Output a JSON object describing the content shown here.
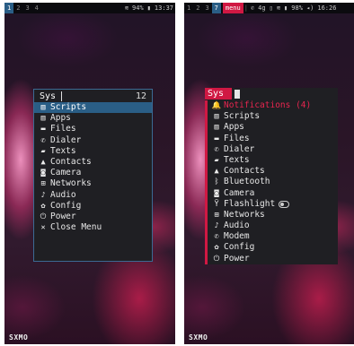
{
  "left": {
    "statusbar": {
      "workspaces": [
        "1",
        "2",
        "3",
        "4"
      ],
      "active_workspace": "1",
      "wifi_icon": "wifi-icon",
      "battery": "94%",
      "battery_icon": "battery-icon",
      "time": "13:37"
    },
    "menu": {
      "prompt": "Sys",
      "count": "12",
      "items": [
        {
          "icon": "scripts-icon",
          "glyph": "▥",
          "label": "Scripts",
          "selected": true
        },
        {
          "icon": "apps-icon",
          "glyph": "▥",
          "label": "Apps"
        },
        {
          "icon": "folder-icon",
          "glyph": "▬",
          "label": "Files"
        },
        {
          "icon": "phone-icon",
          "glyph": "✆",
          "label": "Dialer"
        },
        {
          "icon": "message-icon",
          "glyph": "▰",
          "label": "Texts"
        },
        {
          "icon": "user-icon",
          "glyph": "▲",
          "label": "Contacts"
        },
        {
          "icon": "camera-icon",
          "glyph": "◙",
          "label": "Camera"
        },
        {
          "icon": "network-icon",
          "glyph": "⊞",
          "label": "Networks"
        },
        {
          "icon": "music-icon",
          "glyph": "♪",
          "label": "Audio"
        },
        {
          "icon": "gear-icon",
          "glyph": "✿",
          "label": "Config"
        },
        {
          "icon": "power-icon",
          "glyph": "⏻",
          "label": "Power"
        },
        {
          "icon": "close-icon",
          "glyph": "✕",
          "label": "Close Menu"
        }
      ]
    },
    "logo": "SXMO"
  },
  "right": {
    "statusbar": {
      "workspaces": [
        "1",
        "2",
        "3",
        "7"
      ],
      "active_workspace": "7",
      "menu_tag": "menu",
      "phone_icon": "phone-icon",
      "network": "4g",
      "mic_icon": "mic-icon",
      "wifi_icon": "wifi-icon",
      "battery": "98%",
      "battery_icon": "battery-icon",
      "volume_icon": "volume-icon",
      "time": "16:26"
    },
    "menu": {
      "prompt": "Sys",
      "items": [
        {
          "icon": "bell-icon",
          "glyph": "🔔",
          "label": "Notifications (4)",
          "notif": true
        },
        {
          "icon": "scripts-icon",
          "glyph": "▥",
          "label": "Scripts"
        },
        {
          "icon": "apps-icon",
          "glyph": "▥",
          "label": "Apps"
        },
        {
          "icon": "folder-icon",
          "glyph": "▬",
          "label": "Files"
        },
        {
          "icon": "phone-icon",
          "glyph": "✆",
          "label": "Dialer"
        },
        {
          "icon": "message-icon",
          "glyph": "▰",
          "label": "Texts"
        },
        {
          "icon": "user-icon",
          "glyph": "▲",
          "label": "Contacts"
        },
        {
          "icon": "bluetooth-icon",
          "glyph": "ᛒ",
          "label": "Bluetooth"
        },
        {
          "icon": "camera-icon",
          "glyph": "◙",
          "label": "Camera"
        },
        {
          "icon": "flashlight-icon",
          "glyph": "Ÿ",
          "label": "Flashlight",
          "toggle": true
        },
        {
          "icon": "network-icon",
          "glyph": "⊞",
          "label": "Networks"
        },
        {
          "icon": "music-icon",
          "glyph": "♪",
          "label": "Audio"
        },
        {
          "icon": "phone-icon",
          "glyph": "✆",
          "label": "Modem"
        },
        {
          "icon": "gear-icon",
          "glyph": "✿",
          "label": "Config"
        },
        {
          "icon": "power-icon",
          "glyph": "⏻",
          "label": "Power"
        }
      ]
    },
    "logo": "SXMO"
  }
}
